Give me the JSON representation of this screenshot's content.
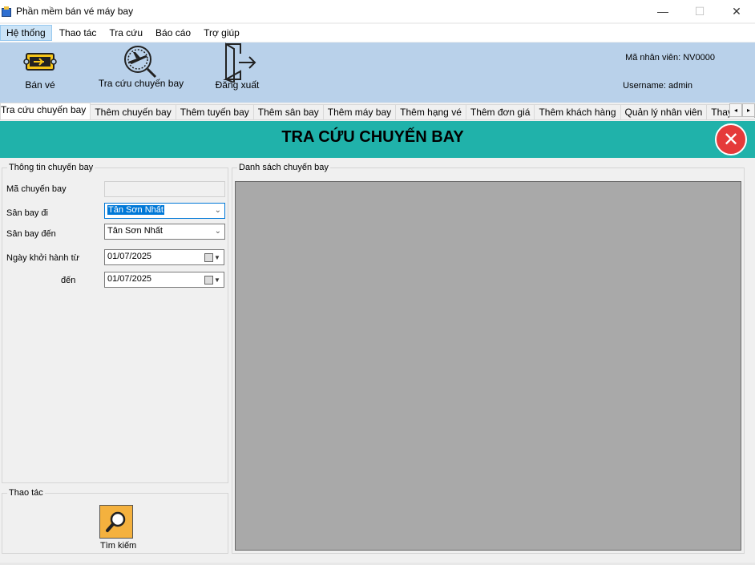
{
  "window": {
    "title": "Phần mềm bán vé máy bay",
    "minimize_icon": "minimize-icon",
    "maximize_icon": "maximize-icon",
    "close_icon": "close-icon",
    "minimize_glyph": "—",
    "maximize_glyph": "☐",
    "close_glyph": "✕"
  },
  "menu": {
    "items": [
      "Hệ thống",
      "Thao tác",
      "Tra cứu",
      "Báo cáo",
      "Trợ giúp"
    ]
  },
  "toolbar": {
    "sell_ticket_label": "Bán vé",
    "flight_lookup_label": "Tra cứu chuyến bay",
    "logout_label": "Đăng xuất",
    "employee_id_text": "Mã nhân viên: NV0000",
    "username_text": "Username: admin"
  },
  "tabs": {
    "items": [
      "Tra cứu chuyến bay",
      "Thêm chuyến bay",
      "Thêm tuyến bay",
      "Thêm sân bay",
      "Thêm máy bay",
      "Thêm hạng vé",
      "Thêm đơn giá",
      "Thêm khách hàng",
      "Quản lý nhân viên",
      "Thay đổi quy định"
    ],
    "active_index": 0,
    "scroll_left": "◂",
    "scroll_right": "▸"
  },
  "banner": {
    "title": "TRA CỨU CHUYẾN BAY",
    "close_glyph": "✕",
    "color": "#20b2aa"
  },
  "flight_info": {
    "legend": "Thông tin chuyến bay",
    "flight_code_label": "Mã chuyến bay",
    "flight_code_value": "",
    "from_airport_label": "Sân bay đi",
    "from_airport_value": "Tân Sơn Nhất",
    "to_airport_label": "Sân bay đến",
    "to_airport_value": "Tân Sơn Nhất",
    "date_from_label": "Ngày khởi hành từ",
    "date_from_value": "01/07/2025",
    "date_to_label": "đến",
    "date_to_value": "01/07/2025"
  },
  "flight_list": {
    "legend": "Danh sách chuyến bay"
  },
  "actions": {
    "legend": "Thao tác",
    "search_label": "Tìm kiếm"
  }
}
